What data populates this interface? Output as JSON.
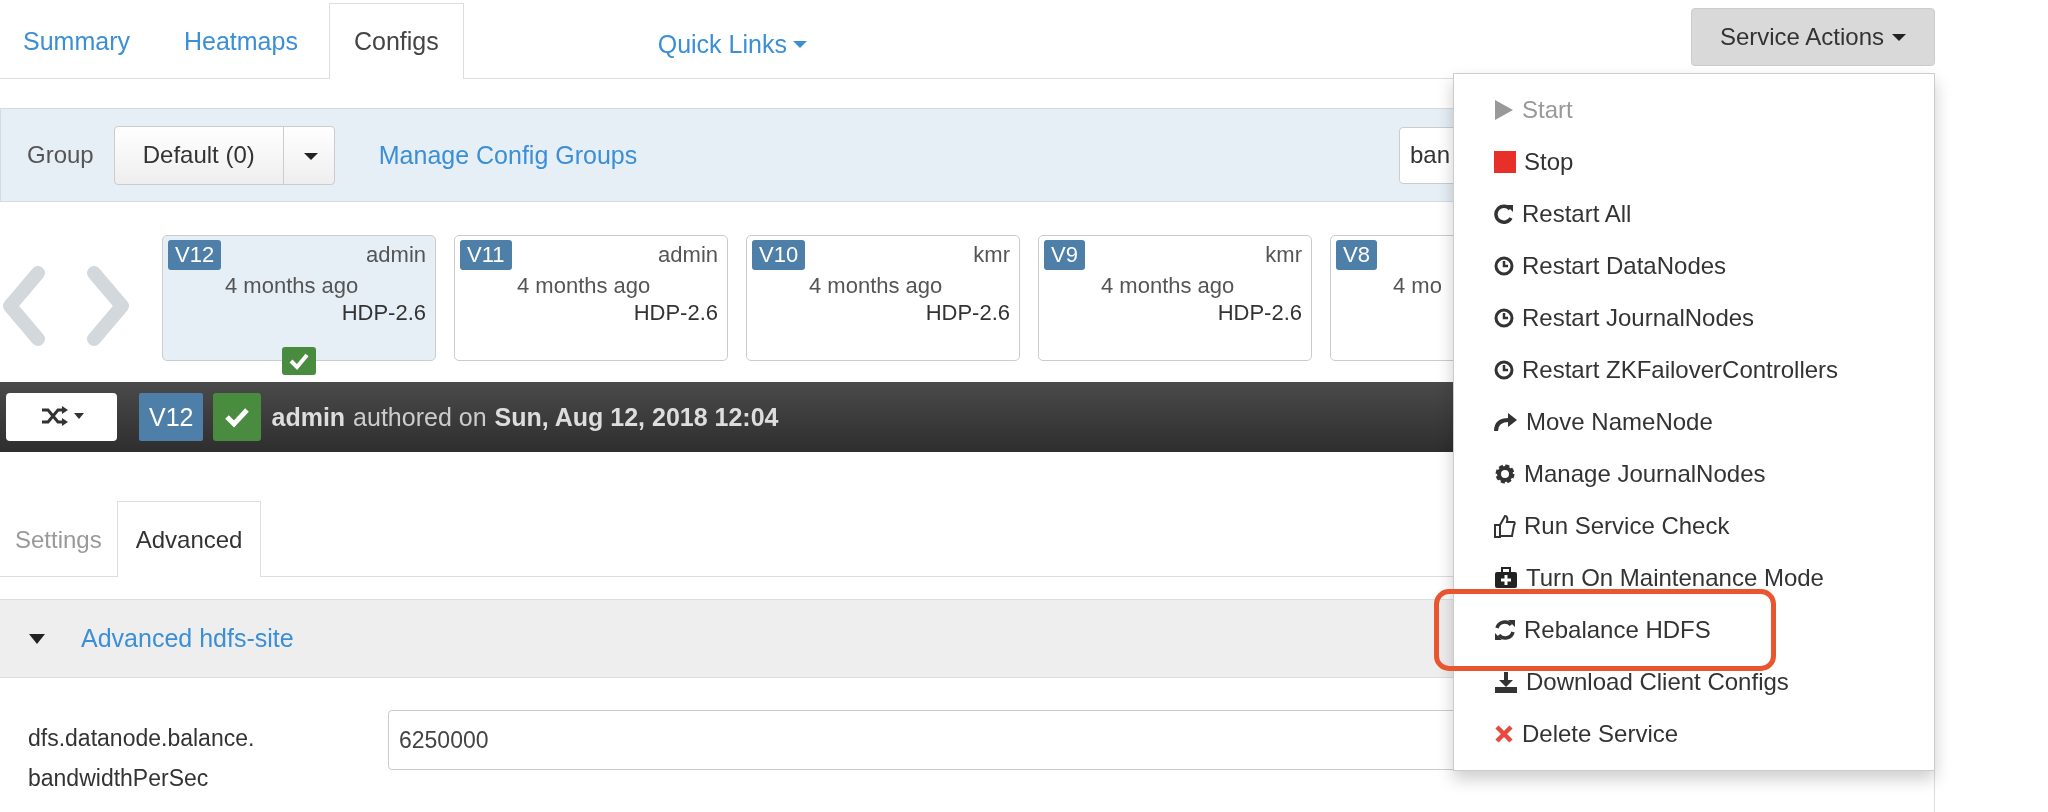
{
  "tabs": [
    {
      "label": "Summary",
      "selected": false
    },
    {
      "label": "Heatmaps",
      "selected": false
    },
    {
      "label": "Configs",
      "selected": true
    }
  ],
  "quick_links": {
    "label": "Quick Links"
  },
  "service_actions": {
    "label": "Service Actions",
    "expanded": true
  },
  "group_bar": {
    "label": "Group",
    "dropdown": {
      "value": "Default (0)"
    },
    "manage_link": "Manage Config Groups",
    "search": {
      "value": "ban"
    }
  },
  "versions": [
    {
      "version": "V12",
      "author": "admin",
      "time": "4 months ago",
      "stack": "HDP-2.6",
      "selected": true,
      "current": true
    },
    {
      "version": "V11",
      "author": "admin",
      "time": "4 months ago",
      "stack": "HDP-2.6",
      "selected": false,
      "current": false
    },
    {
      "version": "V10",
      "author": "kmr",
      "time": "4 months ago",
      "stack": "HDP-2.6",
      "selected": false,
      "current": false
    },
    {
      "version": "V9",
      "author": "kmr",
      "time": "4 months ago",
      "stack": "HDP-2.6",
      "selected": false,
      "current": false
    },
    {
      "version": "V8",
      "time": "4 mo",
      "selected": false,
      "current": false
    }
  ],
  "version_bar": {
    "version": "V12",
    "current": true,
    "author": "admin",
    "text": "authored on",
    "date": "Sun, Aug 12, 2018 12:04"
  },
  "sub_tabs": [
    {
      "label": "Settings",
      "selected": false
    },
    {
      "label": "Advanced",
      "selected": true
    }
  ],
  "section": {
    "title": "Advanced hdfs-site",
    "expanded": true
  },
  "properties": [
    {
      "name": "dfs.datanode.balance.\nbandwidthPerSec",
      "value": "6250000"
    }
  ],
  "menu_items": [
    {
      "kind": "play",
      "label": "Start",
      "disabled": true,
      "highlighted": false
    },
    {
      "kind": "stop",
      "label": "Stop",
      "disabled": false,
      "highlighted": false
    },
    {
      "kind": "refresh",
      "label": "Restart All",
      "disabled": false,
      "highlighted": false
    },
    {
      "kind": "clock",
      "label": "Restart DataNodes",
      "disabled": false,
      "highlighted": false
    },
    {
      "kind": "clock",
      "label": "Restart JournalNodes",
      "disabled": false,
      "highlighted": false
    },
    {
      "kind": "clock",
      "label": "Restart ZKFailoverControllers",
      "disabled": false,
      "highlighted": false
    },
    {
      "kind": "share",
      "label": "Move NameNode",
      "disabled": false,
      "highlighted": false
    },
    {
      "kind": "gear",
      "label": "Manage JournalNodes",
      "disabled": false,
      "highlighted": false
    },
    {
      "kind": "thumb",
      "label": "Run Service Check",
      "disabled": false,
      "highlighted": false
    },
    {
      "kind": "medkit",
      "label": "Turn On Maintenance Mode",
      "disabled": false,
      "highlighted": false
    },
    {
      "kind": "sync",
      "label": "Rebalance HDFS",
      "disabled": false,
      "highlighted": true
    },
    {
      "kind": "download",
      "label": "Download Client Configs",
      "disabled": false,
      "highlighted": false
    },
    {
      "kind": "delete",
      "label": "Delete Service",
      "disabled": false,
      "highlighted": false
    }
  ]
}
